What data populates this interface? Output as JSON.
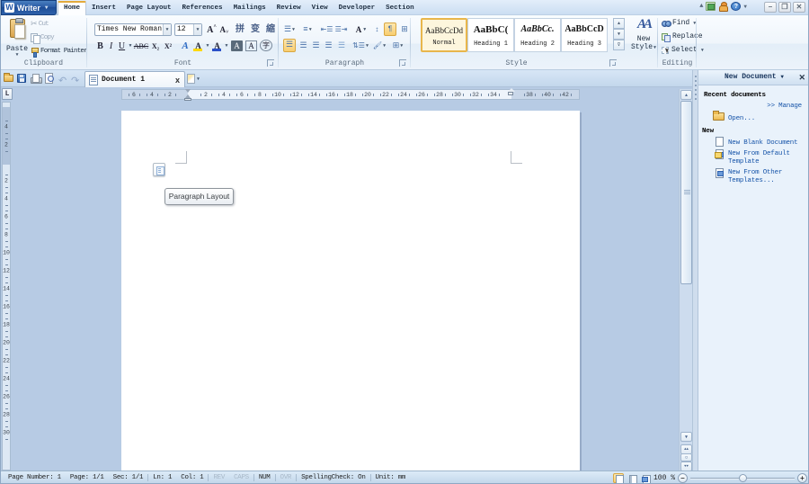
{
  "titlebar": {
    "app_button": "Writer",
    "logo_letter": "W",
    "tabs": [
      {
        "label": "Home",
        "active": true
      },
      {
        "label": "Insert"
      },
      {
        "label": "Page Layout"
      },
      {
        "label": "References"
      },
      {
        "label": "Mailings"
      },
      {
        "label": "Review"
      },
      {
        "label": "View"
      },
      {
        "label": "Developer"
      },
      {
        "label": "Section"
      }
    ],
    "help_glyph": "?",
    "window_buttons": {
      "minimize": "–",
      "restore": "❐",
      "close": "✕"
    }
  },
  "ribbon": {
    "clipboard": {
      "label": "Clipboard",
      "paste": "Paste",
      "cut": "Cut",
      "copy": "Copy",
      "format_painter": "Format Painter"
    },
    "font": {
      "label": "Font",
      "family": "Times New Roman",
      "size": "12",
      "bold": "B",
      "italic": "I",
      "underline": "U",
      "strike": "ABC",
      "sub": "X₂",
      "sup": "X²",
      "grow": "A",
      "shrink": "A",
      "case1": "拼",
      "case2": "变",
      "effect": "A",
      "highlight": "A",
      "color": "A",
      "shade": "A",
      "border": "A",
      "enclose": "字"
    },
    "paragraph": {
      "label": "Paragraph"
    },
    "style": {
      "label": "Style",
      "cards": [
        {
          "sample": "AaBbCcDd",
          "name": "Normal",
          "selected": true
        },
        {
          "sample": "AaBbC(",
          "name": "Heading 1"
        },
        {
          "sample": "AaBbCc.",
          "name": "Heading 2"
        },
        {
          "sample": "AaBbCcD",
          "name": "Heading 3"
        }
      ],
      "new_style": "New\nStyle"
    },
    "editing": {
      "label": "Editing",
      "find": "Find",
      "replace": "Replace",
      "select": "Select"
    }
  },
  "docbar": {
    "tab_title": "Document 1",
    "close_glyph": "x"
  },
  "ruler": {
    "left_numbers": [
      "6",
      "4",
      "2"
    ],
    "mid_numbers": [
      "2",
      "4",
      "6",
      "8",
      "10",
      "12",
      "14",
      "16",
      "18",
      "20",
      "22",
      "24",
      "26",
      "28",
      "30",
      "32",
      "34"
    ],
    "right_numbers": [
      "38",
      "40",
      "42"
    ],
    "tab_selector": "L",
    "v_top": [
      "4",
      "2"
    ],
    "v_body": [
      "2",
      "4",
      "6",
      "8",
      "10",
      "12",
      "14",
      "16",
      "18",
      "20",
      "22",
      "24",
      "26",
      "28",
      "30"
    ]
  },
  "page": {
    "tooltip": "Paragraph Layout"
  },
  "sidebar": {
    "title": "New Document",
    "recent_header": "Recent documents",
    "manage": ">> Manage",
    "open": "Open...",
    "new_header": "New",
    "item1": "New Blank Document",
    "item2": "New From Default\nTemplate",
    "item3": "New From Other\nTemplates..."
  },
  "statusbar": {
    "fields": [
      {
        "t": "Page Number: 1"
      },
      {
        "t": "Page: 1/1"
      },
      {
        "t": "Sec: 1/1",
        "sep": true
      },
      {
        "t": "Ln: 1"
      },
      {
        "t": "Col: 1",
        "sep": true
      },
      {
        "t": "REV",
        "dim": true
      },
      {
        "t": "CAPS",
        "dim": true,
        "sep": true
      },
      {
        "t": "NUM",
        "sep": true
      },
      {
        "t": "OVR",
        "dim": true,
        "sep": true
      },
      {
        "t": "SpellingCheck: On",
        "sep": true
      },
      {
        "t": "Unit: mm"
      }
    ],
    "zoom": "100 %",
    "zoom_out": "–",
    "zoom_in": "+"
  }
}
